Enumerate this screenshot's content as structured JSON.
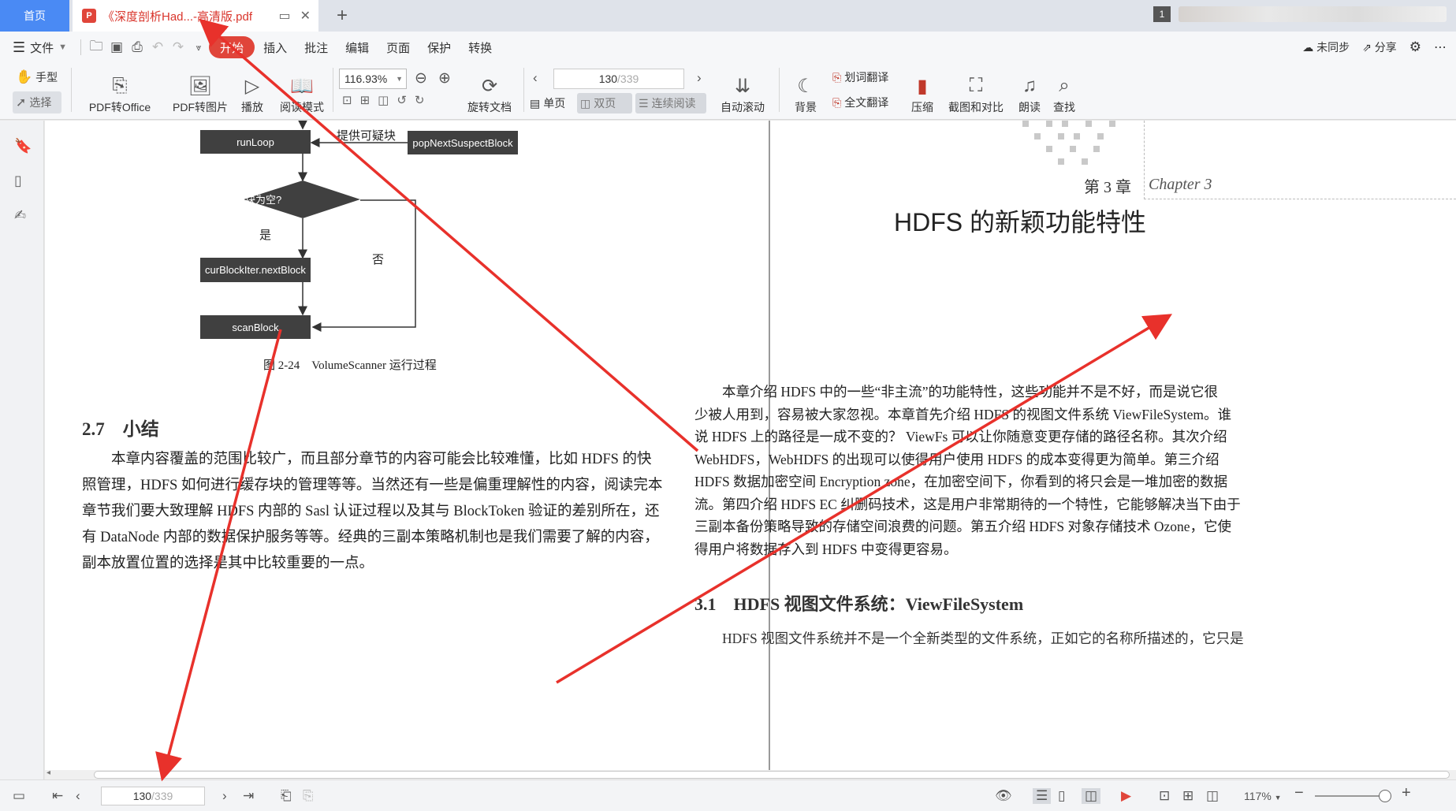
{
  "tabs": {
    "home_label": "首页",
    "doc_badge": "P",
    "doc_title": "《深度剖析Had...-高清版.pdf",
    "counter": "1"
  },
  "menu": {
    "file": "文件",
    "items": [
      "开始",
      "插入",
      "批注",
      "编辑",
      "页面",
      "保护",
      "转换"
    ],
    "right": {
      "sync": "未同步",
      "share": "分享"
    }
  },
  "toolbar": {
    "hand": "手型",
    "select": "选择",
    "pdf_to_office": "PDF转Office",
    "pdf_to_image": "PDF转图片",
    "play": "播放",
    "read_mode": "阅读模式",
    "zoom_value": "116.93%",
    "rotate": "旋转文档",
    "page_current": "130",
    "page_total": "/339",
    "single": "单页",
    "double": "双页",
    "continuous": "连续阅读",
    "auto_scroll": "自动滚动",
    "background": "背景",
    "word_translate": "划词翻译",
    "full_translate": "全文翻译",
    "compress": "压缩",
    "screenshot_compare": "截图和对比",
    "read_aloud": "朗读",
    "find": "查找"
  },
  "left_page": {
    "flowchart": {
      "runloop": "runLoop",
      "provide_label": "提供可疑块",
      "pop_next": "popNextSuspectBlock",
      "decision": "可疑块为空?",
      "yes": "是",
      "no": "否",
      "next_block": "curBlockIter.nextBlock",
      "scan_block": "scanBlock",
      "caption": "图 2-24    VolumeScanner 运行过程"
    },
    "section_heading": "2.7    小结",
    "paragraph": [
      "        本章内容覆盖的范围比较广，而且部分章节的内容可能会比较难懂，比如 HDFS 的快",
      "照管理，HDFS 如何进行缓存块的管理等等。当然还有一些是偏重理解性的内容，阅读完本",
      "章节我们要大致理解 HDFS 内部的 Sasl 认证过程以及其与 BlockToken 验证的差别所在，还",
      "有 DataNode 内部的数据保护服务等等。经典的三副本策略机制也是我们需要了解的内容，",
      "副本放置位置的选择是其中比较重要的一点。"
    ]
  },
  "right_page": {
    "chapter_label": "第 3 章",
    "chapter_script": "Chapter 3",
    "chapter_title": "HDFS 的新颖功能特性",
    "intro": [
      "        本章介绍 HDFS 中的一些“非主流”的功能特性，这些功能并不是不好，而是说它很",
      "少被人用到，容易被大家忽视。本章首先介绍 HDFS 的视图文件系统 ViewFileSystem。谁",
      "说 HDFS 上的路径是一成不变的？ ViewFs 可以让你随意变更存储的路径名称。其次介绍",
      "WebHDFS，WebHDFS 的出现可以使得用户使用 HDFS 的成本变得更为简单。第三介绍",
      "HDFS 数据加密空间 Encryption zone，在加密空间下，你看到的将只会是一堆加密的数据",
      "流。第四介绍 HDFS EC 纠删码技术，这是用户非常期待的一个特性，它能够解决当下由于",
      "三副本备份策略导致的存储空间浪费的问题。第五介绍 HDFS 对象存储技术 Ozone，它使",
      "得用户将数据存入到 HDFS 中变得更容易。"
    ],
    "section_heading": "3.1    HDFS 视图文件系统：ViewFileSystem",
    "section_text": "        HDFS 视图文件系统并不是一个全新类型的文件系统，正如它的名称所描述的，它只是"
  },
  "statusbar": {
    "page_current": "130",
    "page_total": "/339",
    "zoom": "117%"
  },
  "colors": {
    "accent": "#e0453a",
    "tab_home": "#4a8af4",
    "annotation_arrow": "#e8312b"
  }
}
